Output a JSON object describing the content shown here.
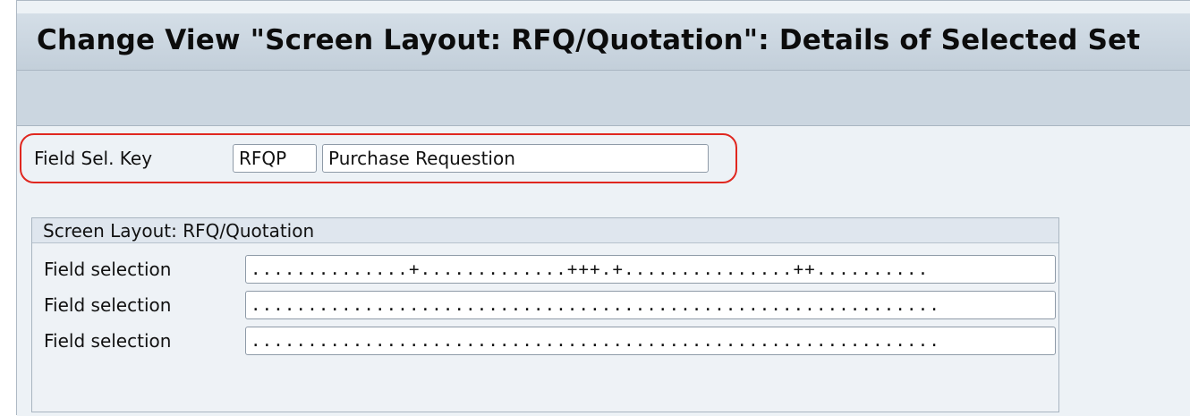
{
  "window": {
    "title": "Change View \"Screen Layout: RFQ/Quotation\": Details of Selected Set"
  },
  "key": {
    "label": "Field Sel. Key",
    "code": "RFQP",
    "description": "Purchase Requestion"
  },
  "group": {
    "title": "Screen Layout: RFQ/Quotation",
    "rows": [
      {
        "label": "Field selection",
        "value": "..............+.............+++.+...............++.........."
      },
      {
        "label": "Field selection",
        "value": "............................................................."
      },
      {
        "label": "Field selection",
        "value": "............................................................."
      }
    ]
  },
  "colors": {
    "highlight": "#e0271f",
    "title_bar": "#c9d5df"
  }
}
